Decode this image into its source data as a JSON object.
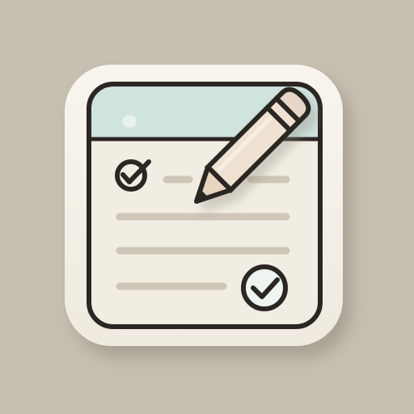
{
  "icon": {
    "name": "checklist-app-icon",
    "depicts": [
      "notepad-icon",
      "pencil-icon",
      "checkmark-icon"
    ]
  },
  "colors": {
    "background": "#c7bfb1",
    "tile": "#f4f0e6",
    "paper": "#f1ede3",
    "header": "#cfe3df",
    "outline": "#2b2623",
    "line": "#cfc6b8",
    "pencil_body": "#efe2d3",
    "pencil_wood": "#e9d4bf",
    "check_fill": "#eef5f1"
  },
  "checklist": {
    "items": [
      {
        "checked": true
      },
      {
        "checked": false
      },
      {
        "checked": false
      },
      {
        "checked": true
      }
    ]
  }
}
